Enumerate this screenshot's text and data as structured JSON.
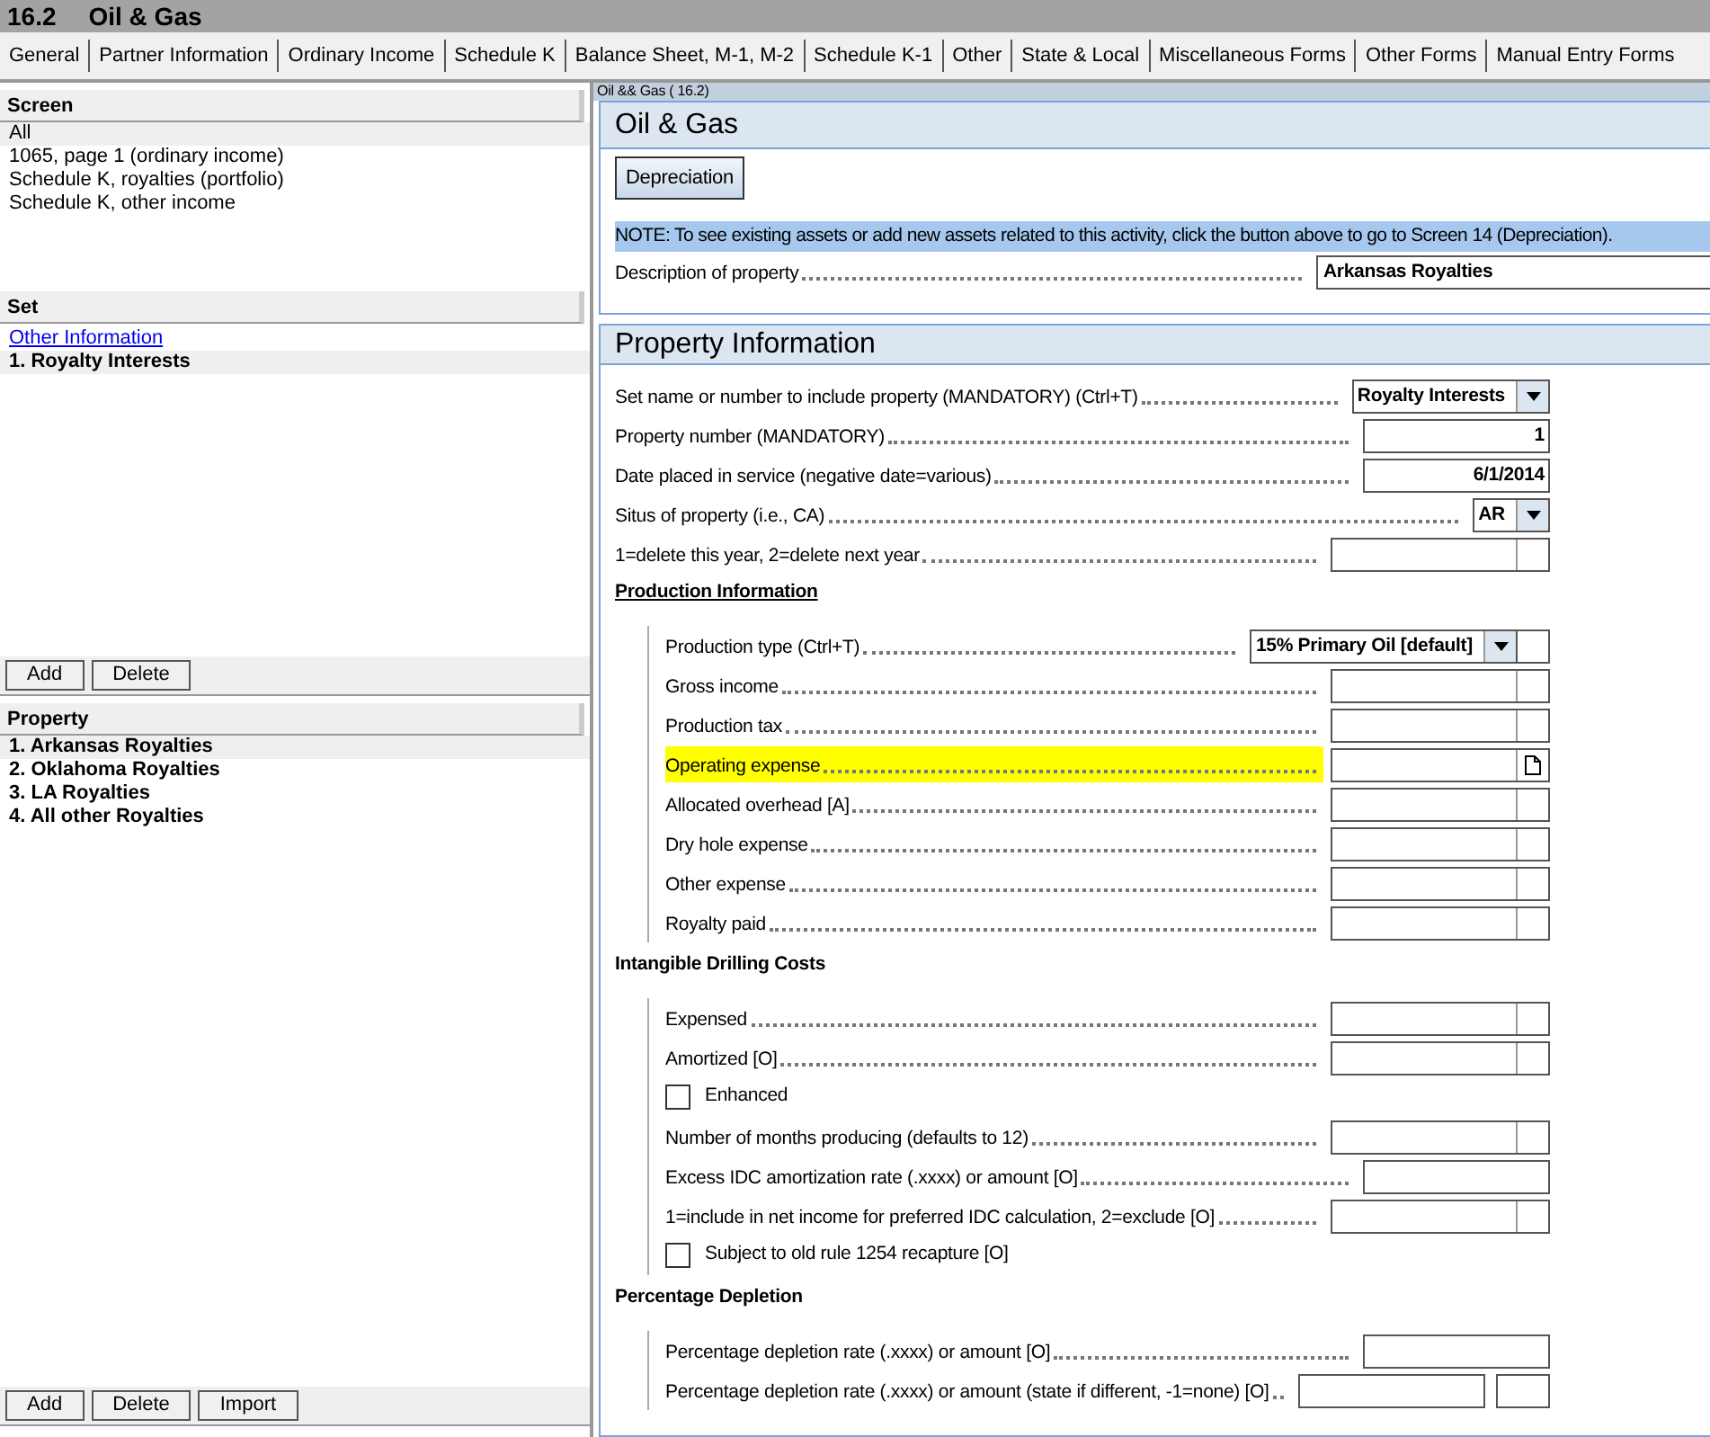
{
  "title_bar": {
    "number": "16.2",
    "title": "Oil & Gas"
  },
  "tabs": [
    {
      "label": "General"
    },
    {
      "label": "Partner Information"
    },
    {
      "label": "Ordinary Income"
    },
    {
      "label": "Schedule K"
    },
    {
      "label": "Balance Sheet, M-1, M-2"
    },
    {
      "label": "Schedule K-1"
    },
    {
      "label": "Other"
    },
    {
      "label": "State & Local"
    },
    {
      "label": "Miscellaneous Forms"
    },
    {
      "label": "Other Forms"
    },
    {
      "label": "Manual Entry Forms"
    }
  ],
  "sidebar": {
    "screen": {
      "heading": "Screen",
      "items": [
        {
          "label": "All",
          "selected": true
        },
        {
          "label": "1065, page 1 (ordinary income)",
          "selected": false
        },
        {
          "label": "Schedule K, royalties (portfolio)",
          "selected": false
        },
        {
          "label": "Schedule K, other income",
          "selected": false
        }
      ]
    },
    "set": {
      "heading": "Set",
      "link": "Other Information",
      "items": [
        {
          "label": "1. Royalty Interests",
          "selected": true
        }
      ],
      "buttons": [
        "Add",
        "Delete"
      ]
    },
    "property": {
      "heading": "Property",
      "items": [
        {
          "label": "1. Arkansas Royalties",
          "selected": true
        },
        {
          "label": "2. Oklahoma Royalties",
          "selected": false
        },
        {
          "label": "3. LA Royalties",
          "selected": false
        },
        {
          "label": "4. All other Royalties",
          "selected": false
        }
      ],
      "buttons": [
        "Add",
        "Delete",
        "Import"
      ]
    }
  },
  "form": {
    "caption": "Oil && Gas ( 16.2)",
    "header": {
      "title": "Oil & Gas",
      "button": "Depreciation",
      "note": "NOTE: To see existing assets or add new assets related to this activity, click the button above to go to Screen 14 (Depreciation).",
      "description": {
        "label": "Description of property",
        "value": "Arkansas Royalties"
      }
    },
    "section": {
      "title": "Property Information",
      "rows": [
        {
          "kind": "dropdown",
          "label": "Set name or number to include property (MANDATORY) (Ctrl+T)",
          "value": "Royalty Interests",
          "extra_box": false
        },
        {
          "kind": "field",
          "label": "Property number (MANDATORY)",
          "value": "1",
          "split": false
        },
        {
          "kind": "field",
          "label": "Date placed in service (negative date=various)",
          "value": "6/1/2014",
          "split": false
        },
        {
          "kind": "dropdown",
          "label": "Situs of property (i.e., CA)",
          "value": "AR",
          "extra_box": false
        },
        {
          "kind": "field",
          "label": "1=delete this year, 2=delete next year",
          "split": true
        },
        {
          "kind": "group",
          "title": "Production Information",
          "underline": true,
          "children": [
            {
              "kind": "dropdown",
              "label": "Production type (Ctrl+T)",
              "value": "15% Primary Oil [default]",
              "extra_box": true
            },
            {
              "kind": "field",
              "label": "Gross income",
              "split": true
            },
            {
              "kind": "field",
              "label": "Production tax",
              "split": true
            },
            {
              "kind": "field",
              "label": "Operating expense",
              "split": true,
              "highlighted": true,
              "attachment": true
            },
            {
              "kind": "field",
              "label": "Allocated overhead [A]",
              "split": true
            },
            {
              "kind": "field",
              "label": "Dry hole expense",
              "split": true
            },
            {
              "kind": "field",
              "label": "Other expense",
              "split": true
            },
            {
              "kind": "field",
              "label": "Royalty paid",
              "split": true
            }
          ]
        },
        {
          "kind": "group",
          "title": "Intangible Drilling Costs",
          "underline": false,
          "children": [
            {
              "kind": "field",
              "label": "Expensed",
              "split": true
            },
            {
              "kind": "field",
              "label": "Amortized [O]",
              "split": true
            },
            {
              "kind": "checkbox",
              "label": "Enhanced",
              "checked": false
            },
            {
              "kind": "field",
              "label": "Number of months producing (defaults to 12)",
              "split": true
            },
            {
              "kind": "field",
              "label": "Excess IDC amortization rate (.xxxx) or amount [O]",
              "split": false
            },
            {
              "kind": "field",
              "label": "1=include in net income for preferred IDC calculation, 2=exclude [O]",
              "split": true
            },
            {
              "kind": "checkbox",
              "label": "Subject to old rule 1254 recapture [O]",
              "checked": false
            }
          ]
        },
        {
          "kind": "group",
          "title": "Percentage Depletion",
          "underline": false,
          "children": [
            {
              "kind": "field",
              "label": "Percentage depletion rate (.xxxx) or amount [O]",
              "split": false
            },
            {
              "kind": "field",
              "label": "Percentage depletion rate (.xxxx) or amount (state if different, -1=none) [O]",
              "split": false,
              "separate_box": true
            }
          ]
        }
      ]
    }
  }
}
